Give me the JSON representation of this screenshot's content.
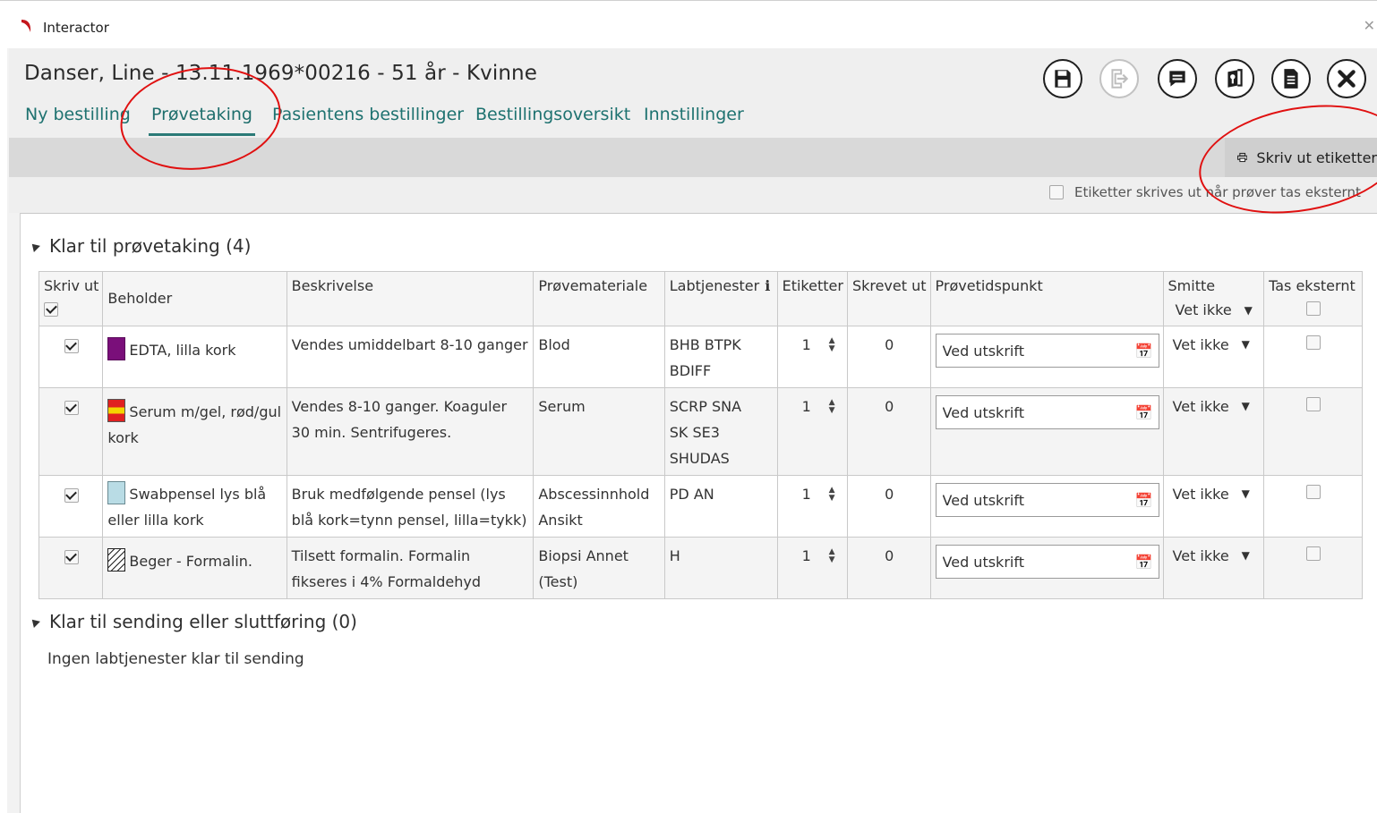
{
  "window": {
    "title": "Interactor",
    "close_glyph": "✕"
  },
  "patient": {
    "header": "Danser, Line - 13.11.1969*00216 - 51 år - Kvinne"
  },
  "tabs": [
    {
      "label": "Ny bestilling"
    },
    {
      "label": "Prøvetaking",
      "active": true
    },
    {
      "label": "Pasientens bestillinger"
    },
    {
      "label": "Bestillingsoversikt"
    },
    {
      "label": "Innstillinger"
    }
  ],
  "toolbar": [
    {
      "icon": "save-icon"
    },
    {
      "icon": "export-icon",
      "disabled": true
    },
    {
      "icon": "comment-icon"
    },
    {
      "icon": "book-icon"
    },
    {
      "icon": "document-icon"
    },
    {
      "icon": "close-icon"
    }
  ],
  "actions": {
    "print_labels": "Skriv ut etiketter",
    "external_labels_checkbox": "Etiketter skrives ut når prøver tas eksternt"
  },
  "section_ready": {
    "title": "Klar til prøvetaking (4)",
    "columns": {
      "print": "Skriv ut",
      "container": "Beholder",
      "description": "Beskrivelse",
      "material": "Prøvemateriale",
      "lab_services": "Labtjenester",
      "labels": "Etiketter",
      "printed": "Skrevet ut",
      "sample_time": "Prøvetidspunkt",
      "infection": "Smitte",
      "external": "Tas eksternt"
    },
    "header_infection_value": "Vet ikke",
    "rows": [
      {
        "container": "EDTA, lilla kork",
        "description": "Vendes umiddelbart 8-10 ganger",
        "material": "Blod",
        "lab_services": "BHB  BTPK\nBDIFF",
        "labels": "1",
        "printed": "0",
        "sample_time": "Ved utskrift",
        "infection": "Vet ikke"
      },
      {
        "container": "Serum m/gel, rød/gul kork",
        "description": "Vendes 8-10 ganger. Koaguler 30 min. Sentrifugeres.",
        "material": "Serum",
        "lab_services": "SCRP  SNA\nSK  SE3\nSHUDAS",
        "labels": "1",
        "printed": "0",
        "sample_time": "Ved utskrift",
        "infection": "Vet ikke"
      },
      {
        "container": "Swabpensel lys blå eller lilla kork",
        "description": "Bruk medfølgende pensel (lys blå kork=tynn pensel, lilla=tykk)",
        "material": "Abscessinnhold Ansikt",
        "lab_services": "PD  AN",
        "labels": "1",
        "printed": "0",
        "sample_time": "Ved utskrift",
        "infection": "Vet ikke"
      },
      {
        "container": "Beger - Formalin.",
        "description": "Tilsett formalin. Formalin fikseres i 4% Formaldehyd",
        "material": "Biopsi Annet (Test)",
        "lab_services": "H",
        "labels": "1",
        "printed": "0",
        "sample_time": "Ved utskrift",
        "infection": "Vet ikke"
      }
    ]
  },
  "section_send": {
    "title": "Klar til sending eller sluttføring (0)",
    "empty_message": "Ingen labtjenester klar til sending"
  },
  "colors": {
    "accent": "#1e7270",
    "annotation": "#e01010"
  }
}
